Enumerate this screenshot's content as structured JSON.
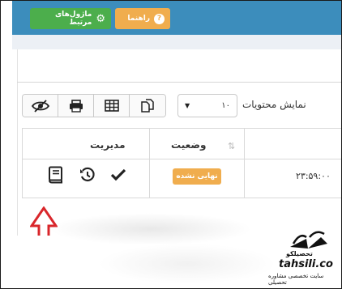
{
  "topbar": {
    "related_modules_label": "ماژول‌های مرتبط",
    "help_label": "راهنما",
    "help_icon_glyph": "?"
  },
  "toolbar": {
    "show_label": "نمایش محتویات",
    "page_size": "۱۰",
    "caret": "▼"
  },
  "table": {
    "headers": {
      "status": "وضعیت",
      "management": "مدیریت"
    },
    "rows": [
      {
        "time": "۲۳:۵۹:۰۰",
        "status": "نهایی نشده"
      }
    ]
  },
  "watermark": {
    "site_fa": "تحصیلکو",
    "site_en": "tahsili.co",
    "tagline": "سایت تخصصی مشاوره تحصیلی"
  },
  "colors": {
    "header_blue": "#3c8dbc",
    "green": "#4cae4c",
    "orange": "#f0ad4e",
    "arrow_red": "#d9262b"
  }
}
